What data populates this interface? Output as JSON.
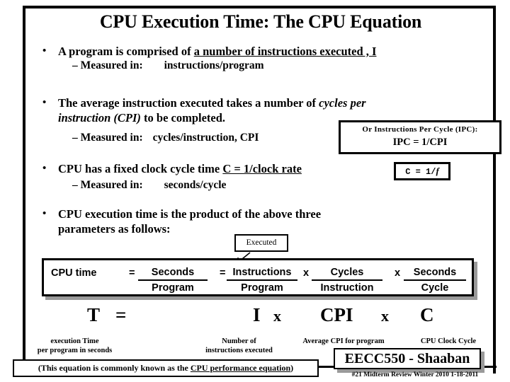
{
  "slide": {
    "title": "CPU Execution Time: The CPU Equation",
    "bullets": [
      {
        "lead": "A program is comprised of ",
        "emphasis": "a number of instructions executed ,  I",
        "sub_label": "–  Measured in:",
        "sub_value": "instructions/program"
      },
      {
        "line1_a": "The average instruction executed takes a number of ",
        "line1_em": "cycles per",
        "line2_em": "instruction (CPI)",
        "line2_b": " to be completed.",
        "sub_label": "–  Measured in:",
        "sub_value": "cycles/instruction,  CPI"
      },
      {
        "lead": "CPU has a fixed clock cycle time  ",
        "emphasis": "C  = 1/clock rate",
        "sub_label": "–  Measured in:",
        "sub_value": "seconds/cycle"
      },
      {
        "line1": "CPU execution time is the product of the above three",
        "line2": "parameters as follows:"
      }
    ],
    "callouts": {
      "ipc": {
        "line1": "Or  Instructions Per Cycle (IPC):",
        "line2": "IPC =  1/CPI"
      },
      "clock": {
        "text": "C   =  1/",
        "var": "f"
      },
      "executed": "Executed"
    },
    "equation_table": {
      "label": "CPU time",
      "terms": [
        {
          "op": "=",
          "numerator": "Seconds",
          "denominator": "Program"
        },
        {
          "op": "=",
          "numerator": "Instructions",
          "denominator": "Program"
        },
        {
          "op": "x",
          "numerator": "Cycles",
          "denominator": "Instruction"
        },
        {
          "op": "x",
          "numerator": "Seconds",
          "denominator": "Cycle"
        }
      ]
    },
    "symbolic_equation": {
      "t": "T",
      "eq": "=",
      "i": "I",
      "x1": "x",
      "cpi": "CPI",
      "x2": "x",
      "c": "C"
    },
    "annotations": [
      {
        "line1": "execution Time",
        "line2": "per program in seconds"
      },
      {
        "line1": "Number of",
        "line2": "instructions executed"
      },
      {
        "line1": "Average CPI for program",
        "line2": ""
      },
      {
        "line1": "CPU Clock Cycle",
        "line2": ""
      }
    ],
    "note": {
      "prefix": "(This equation is commonly known as the ",
      "emphasis": "CPU performance equation",
      "suffix": ")"
    },
    "footer": {
      "title": "EECC550 - Shaaban",
      "subtitle": "#21   Midterm Review  Winter 2010  1-18-2011"
    }
  }
}
